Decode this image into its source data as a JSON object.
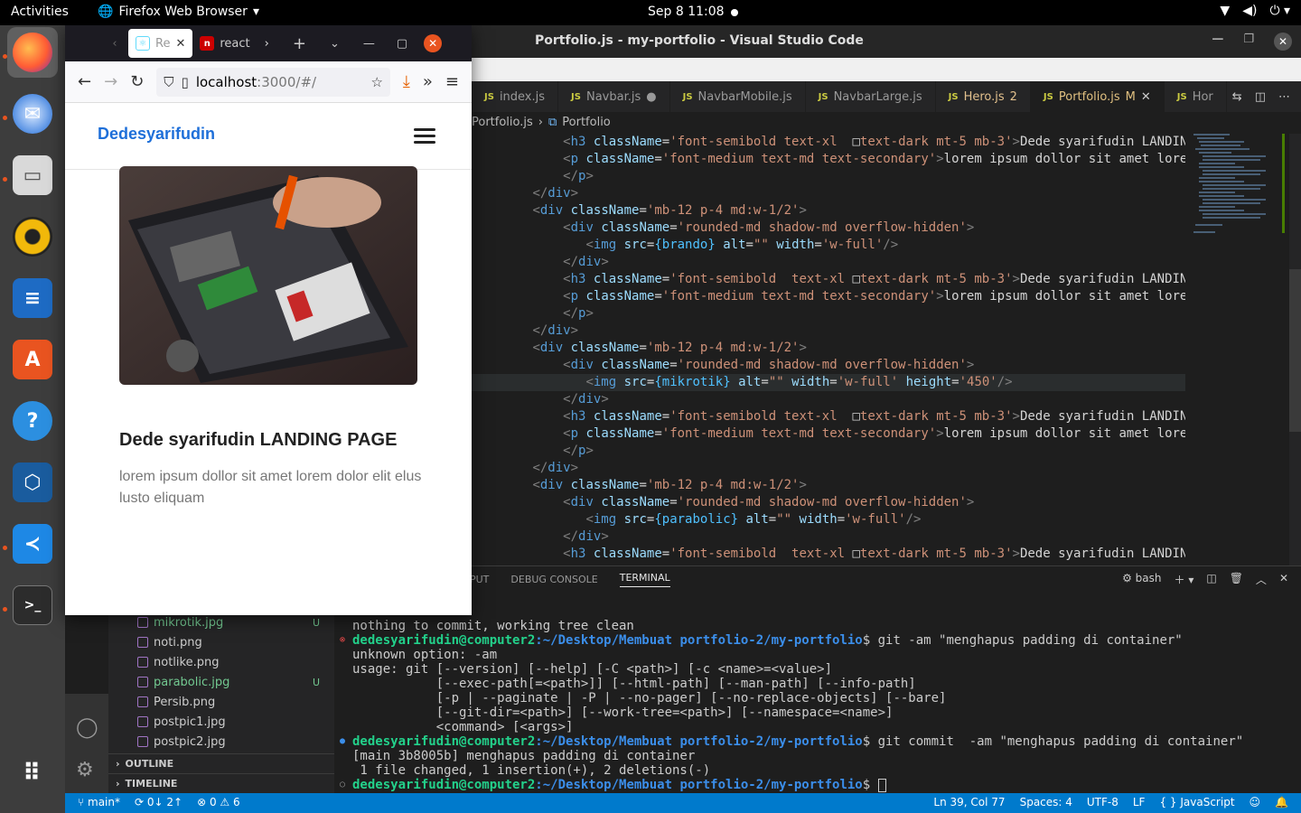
{
  "topbar": {
    "activities": "Activities",
    "app_name": "Firefox Web Browser",
    "clock": "Sep 8  11:08"
  },
  "dock": {
    "items": [
      "firefox-icon",
      "thunderbird-icon",
      "files-icon",
      "rhythmbox-icon",
      "writer-icon",
      "software-icon",
      "help-icon",
      "virtualbox-icon",
      "vscode-icon",
      "terminal-icon",
      "apps-grid-icon"
    ]
  },
  "vscode": {
    "title": "Portfolio.js - my-portfolio - Visual Studio Code",
    "tabs": [
      {
        "label": "index.js",
        "badge": ""
      },
      {
        "label": "Navbar.js",
        "badge": "●"
      },
      {
        "label": "NavbarMobile.js",
        "badge": ""
      },
      {
        "label": "NavbarLarge.js",
        "badge": ""
      },
      {
        "label": "Hero.js",
        "badge": "2"
      },
      {
        "label": "Portfolio.js",
        "badge": "M"
      },
      {
        "label": "Hor",
        "badge": ""
      }
    ],
    "breadcrumb": [
      "Portfolio.js",
      "Portfolio"
    ],
    "explorer": {
      "files": [
        {
          "name": "mikrotik.jpg",
          "status": "U"
        },
        {
          "name": "noti.png",
          "status": ""
        },
        {
          "name": "notlike.png",
          "status": ""
        },
        {
          "name": "parabolic.jpg",
          "status": "U"
        },
        {
          "name": "Persib.png",
          "status": ""
        },
        {
          "name": "postpic1.jpg",
          "status": ""
        },
        {
          "name": "postpic2.jpg",
          "status": ""
        }
      ],
      "outline": "OUTLINE",
      "timeline": "TIMELINE"
    },
    "panel": {
      "tabs": [
        "PUT",
        "DEBUG CONSOLE",
        "TERMINAL"
      ],
      "shell": "bash"
    },
    "terminal": {
      "prompt_user": "dedesyarifudin@computer2",
      "prompt_path": ":~/Desktop/Membuat portfolio-2/my-portfolio",
      "lines": [
        "nothing to commit, working tree clean",
        "unknown option: -am",
        "usage: git [--version] [--help] [-C <path>] [-c <name>=<value>]",
        "           [--exec-path[=<path>]] [--html-path] [--man-path] [--info-path]",
        "           [-p | --paginate | -P | --no-pager] [--no-replace-objects] [--bare]",
        "           [--git-dir=<path>] [--work-tree=<path>] [--namespace=<name>]",
        "           <command> [<args>]",
        "[main 3b8005b] menghapus padding di container",
        " 1 file changed, 1 insertion(+), 2 deletions(-)"
      ],
      "cmd1": "$ git -am \"menghapus padding di container\"",
      "cmd2": "$ git commit  -am \"menghapus padding di container\"",
      "cmd3": "$ "
    },
    "status": {
      "branch": "main*",
      "sync": "0↓ 2↑",
      "problems": "⊗ 0 ⚠ 6",
      "position": "Ln 39, Col 77",
      "spaces": "Spaces: 4",
      "encoding": "UTF-8",
      "eol": "LF",
      "language": "{ } JavaScript"
    }
  },
  "firefox": {
    "tabs": [
      "Re",
      "react"
    ],
    "url_host": "localhost",
    "url_path": ":3000/#/",
    "page": {
      "brand": "Dedesyarifudin",
      "card_title": "Dede syarifudin LANDING PAGE",
      "card_text": "lorem ipsum dollor sit amet lorem dolor elit elus lusto eliquam"
    }
  }
}
